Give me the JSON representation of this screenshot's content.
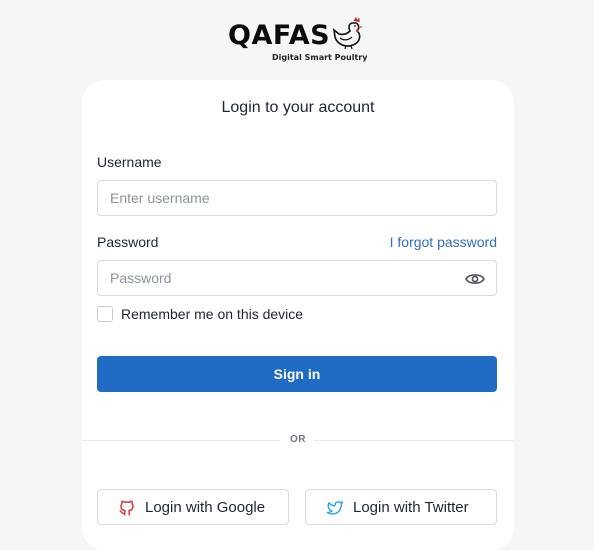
{
  "logo": {
    "name": "QAFAS",
    "tagline": "Digital Smart Poultry"
  },
  "login": {
    "title": "Login to your account",
    "username_label": "Username",
    "username_placeholder": "Enter username",
    "password_label": "Password",
    "forgot_link": "I forgot password",
    "password_placeholder": "Password",
    "remember_label": "Remember me on this device",
    "remember_checked": false,
    "signin_button": "Sign in",
    "divider_text": "OR"
  },
  "social": {
    "google_label": "Login with Google",
    "twitter_label": "Login with Twitter"
  },
  "colors": {
    "primary": "#206bc4",
    "link": "#2d6fbf",
    "google_icon": "#d63939",
    "twitter_icon": "#1da1f2",
    "background": "#f5f6f8"
  },
  "icons": {
    "password_toggle": "eye-icon",
    "google": "github-icon",
    "twitter": "twitter-icon"
  }
}
